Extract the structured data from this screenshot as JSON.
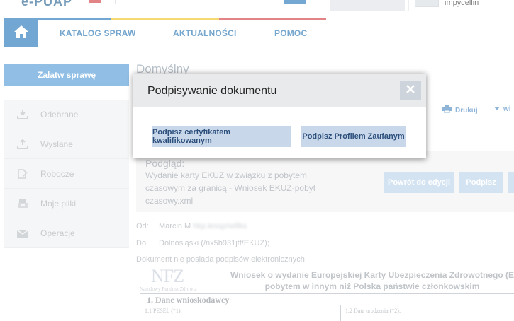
{
  "header": {
    "logo_fragment": "e-PUAP",
    "username": "impycellin"
  },
  "nav": {
    "home_icon": "home-icon",
    "items": [
      {
        "label": "KATALOG SPRAW"
      },
      {
        "label": "AKTUALNOŚCI"
      },
      {
        "label": "POMOC"
      }
    ]
  },
  "sidebar": {
    "action_label": "Załatw sprawę",
    "items": [
      {
        "label": "Odebrane",
        "icon": "inbox-download-icon"
      },
      {
        "label": "Wysłane",
        "icon": "outbox-upload-icon"
      },
      {
        "label": "Robocze",
        "icon": "draft-edit-icon"
      },
      {
        "label": "Moje pliki",
        "icon": "files-tray-icon"
      },
      {
        "label": "Operacje",
        "icon": "envelope-icon"
      }
    ]
  },
  "main": {
    "title": "Domyślny",
    "print_label": "Drukuj",
    "more_label": "wi",
    "preview": {
      "label": "Podgląd:",
      "name": "Wydanie karty EKUZ w związku z pobytem czasowym za granicą - Wniosek EKUZ-pobyt czasowy.xml",
      "back_label": "Powrót do edycji",
      "sign_label": "Podpisz"
    },
    "from_label": "Od:",
    "from_value": "Marcin M",
    "from_hidden": "hkp.lessp/willks",
    "to_label": "Do:",
    "to_value": "Dolnośląski (/nx5b931jtf/EKUZ);",
    "signature_note": "Dokument nie posiada podpisów elektronicznych",
    "document": {
      "logo_text": "NFZ",
      "logo_subtitle": "Narodowy Fundusz Zdrowia",
      "title_line1": "Wniosek o wydanie Europejskiej Karty Ubezpieczenia Zdrowotnego (E",
      "title_line2": "pobytem w innym niż Polska państwie członkowskim",
      "section": "1. Dane wnioskodawcy",
      "field_pesel": "1.1 PESEL (*1):",
      "field_birth": "1.2 Data urodzenia (*2):"
    }
  },
  "modal": {
    "title": "Podpisywanie dokumentu",
    "close_icon": "close-icon",
    "button_qualified": "Podpisz certyfikatem kwalifikowanym",
    "button_trusted": "Podpisz Profilem Zaufanym"
  },
  "colors": {
    "accent_blue": "#1e72b8",
    "stripe": [
      "#1e72b8",
      "#f3c21b",
      "#d0383a"
    ]
  }
}
